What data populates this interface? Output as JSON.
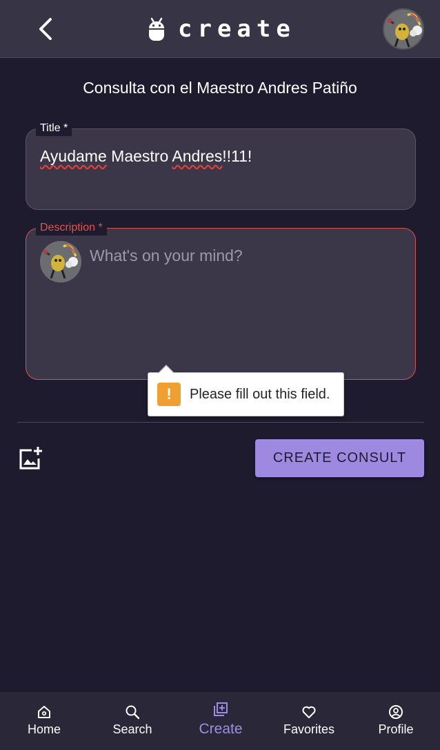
{
  "header": {
    "brand_text": "create",
    "back_icon": "chevron-left-icon",
    "brand_icon": "android-icon"
  },
  "page": {
    "title": "Consulta con el Maestro Andres Patiño"
  },
  "form": {
    "title_label": "Title *",
    "title_value": {
      "w1": "Ayudame",
      "w2": "Maestro",
      "w3": "Andres",
      "w4": "!!11!"
    },
    "description_label": "Description *",
    "description_placeholder": "What's on your mind?",
    "validation_message": "Please fill out this field.",
    "submit_label": "CREATE CONSULT"
  },
  "nav": {
    "items": [
      {
        "label": "Home",
        "icon": "home-icon"
      },
      {
        "label": "Search",
        "icon": "search-icon"
      },
      {
        "label": "Create",
        "icon": "add-box-icon"
      },
      {
        "label": "Favorites",
        "icon": "heart-icon"
      },
      {
        "label": "Profile",
        "icon": "account-circle-icon"
      }
    ],
    "active": "Create"
  },
  "colors": {
    "background": "#1e1b2f",
    "bar": "#373446",
    "accent": "#9d8ae0",
    "error": "#e5534b",
    "warning": "#f0a030"
  }
}
